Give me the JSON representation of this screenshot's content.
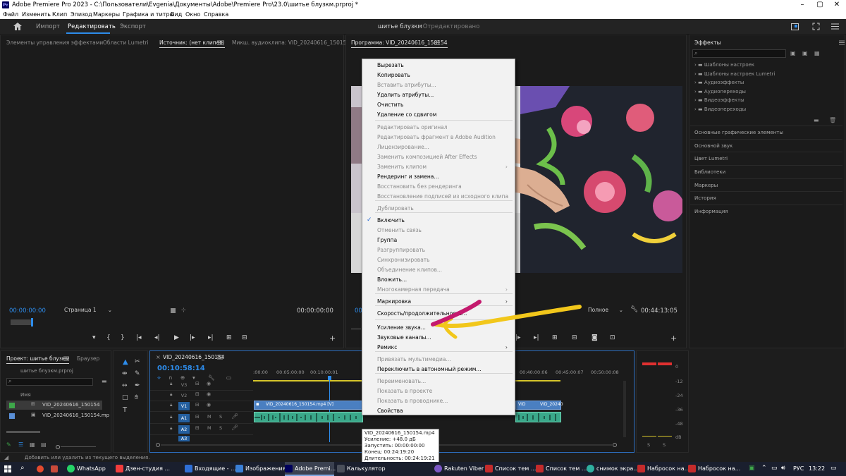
{
  "titlebar": {
    "app_badge": "Pr",
    "title": "Adobe Premiere Pro 2023 - C:\\Пользователи\\Evgenia\\Документы\\Adobe\\Premiere Pro\\23.0\\шитье блузкм.prproj *"
  },
  "menubar": [
    "Файл",
    "Изменить",
    "Клип",
    "Эпизод",
    "Маркеры",
    "Графика и титры",
    "Вид",
    "Окно",
    "Справка"
  ],
  "workspace": {
    "tabs": [
      "Импорт",
      "Редактировать",
      "Экспорт"
    ],
    "active_tab": "Редактировать",
    "project_name": "шитье блузкм",
    "project_status": "- Отредактировано"
  },
  "source_panel": {
    "tabs": [
      "Элементы управления эффектами",
      "Области Lumetri",
      "Источник: (нет клипов)",
      "Микш. аудиоклипа: VID_20240616_150154"
    ],
    "timecode_left": "00:00:00:00",
    "page_select": "Страница 1",
    "timecode_right": "00:00:00:00"
  },
  "program_panel": {
    "tab": "Программа: VID_20240616_150154",
    "timecode_left": "00",
    "quality": "Полное",
    "timecode_right": "00:44:13:05"
  },
  "effects_panel": {
    "title": "Эффекты",
    "search_placeholder": "",
    "items": [
      "Шаблоны настроек",
      "Шаблоны настроек Lumetri",
      "Аудиоэффекты",
      "Аудиопереходы",
      "Видеоэффекты",
      "Видеопереходы"
    ],
    "sections": [
      "Основные графические элементы",
      "Основной звук",
      "Цвет Lumetri",
      "Библиотеки",
      "Маркеры",
      "История",
      "Информация"
    ]
  },
  "project_panel": {
    "tabs": [
      "Проект: шитье блузкм",
      "Браузер"
    ],
    "file_name": "шитье блузкм.prproj",
    "column_name": "Имя",
    "items": [
      "VID_20240616_150154",
      "VID_20240616_150154.mp"
    ]
  },
  "timeline": {
    "sequence_tab": "VID_20240616_150154",
    "timecode": "00:10:58:14",
    "ruler": [
      ":00:00",
      "00:05:00:00",
      "00:10:00:01",
      "00:40:00:06",
      "00:45:00:07",
      "00:50:00:08"
    ],
    "video_tracks": [
      "V3",
      "V2",
      "V1"
    ],
    "audio_tracks": [
      "A1",
      "A2",
      "A3"
    ],
    "clip_label": "VID_20240616_150154.mp4 [V]",
    "clip_label_2": "VID",
    "clip_label_3": "VID_20240"
  },
  "vu_meter": {
    "scale": [
      "0",
      "-12",
      "-24",
      "-36",
      "-48",
      "dB"
    ],
    "solo": [
      "S",
      "S"
    ]
  },
  "status_bar": {
    "message": "Добавить или удалить из текущего выделения."
  },
  "context_menu": {
    "items": [
      {
        "label": "Вырезать",
        "enabled": true
      },
      {
        "label": "Копировать",
        "enabled": true
      },
      {
        "label": "Вставить атрибуты...",
        "enabled": false
      },
      {
        "label": "Удалить атрибуты...",
        "enabled": true
      },
      {
        "label": "Очистить",
        "enabled": true
      },
      {
        "label": "Удаление со сдвигом",
        "enabled": true
      },
      {
        "label": "Редактировать оригинал",
        "enabled": false
      },
      {
        "label": "Редактировать фрагмент в Adobe Audition",
        "enabled": false
      },
      {
        "label": "Лицензирование...",
        "enabled": false
      },
      {
        "label": "Заменить композицией After Effects",
        "enabled": false
      },
      {
        "label": "Заменить клипом",
        "enabled": false,
        "submenu": true
      },
      {
        "label": "Рендеринг и замена...",
        "enabled": true
      },
      {
        "label": "Восстановить без рендеринга",
        "enabled": false
      },
      {
        "label": "Восстановление подписей из исходного клипа",
        "enabled": false
      },
      {
        "label": "Дублировать",
        "enabled": false
      },
      {
        "label": "Включить",
        "enabled": true,
        "checked": true
      },
      {
        "label": "Отменить связь",
        "enabled": false
      },
      {
        "label": "Группа",
        "enabled": true
      },
      {
        "label": "Разгруппировать",
        "enabled": false
      },
      {
        "label": "Синхронизировать",
        "enabled": false
      },
      {
        "label": "Объединение клипов...",
        "enabled": false
      },
      {
        "label": "Вложить...",
        "enabled": true
      },
      {
        "label": "Многокамерная передача",
        "enabled": false,
        "submenu": true
      },
      {
        "label": "Маркировка",
        "enabled": true,
        "submenu": true
      },
      {
        "label": "Скорость/продолжительность...",
        "enabled": true
      },
      {
        "label": "Усиление звука...",
        "enabled": true
      },
      {
        "label": "Звуковые каналы...",
        "enabled": true
      },
      {
        "label": "Ремикс",
        "enabled": true,
        "submenu": true
      },
      {
        "label": "Привязать мультимедиа...",
        "enabled": false
      },
      {
        "label": "Переключить в автономный режим...",
        "enabled": true
      },
      {
        "label": "Переименовать...",
        "enabled": false
      },
      {
        "label": "Показать в проекте",
        "enabled": false
      },
      {
        "label": "Показать в проводнике...",
        "enabled": false
      },
      {
        "label": "Свойства",
        "enabled": true
      }
    ]
  },
  "tooltip": {
    "lines": [
      "VID_20240616_150154.mp4",
      "Усиление: +48.0 дБ",
      "Запустить: 00:00:00:00",
      "Конец: 00:24:19:20",
      "Длительность: 00:24:19:21"
    ]
  },
  "taskbar": {
    "items": [
      "WhatsApp",
      "Дзен-студия ...",
      "Входящие - ...",
      "Изображения",
      "Adobe Premi...",
      "Калькулятор",
      "Rakuten Viber",
      "Список тем ...",
      "Список тем ...",
      "снимок экра...",
      "Набросок на...",
      "Набросок на..."
    ],
    "language": "РУС",
    "time": "13:22"
  },
  "colors": {
    "accent": "#2d8ceb",
    "clip_video": "#4a7fc1",
    "clip_audio": "#3aa88a",
    "annotation_pink": "#c41a6e",
    "annotation_yellow": "#f2c71b",
    "vu_red": "#e03030"
  }
}
